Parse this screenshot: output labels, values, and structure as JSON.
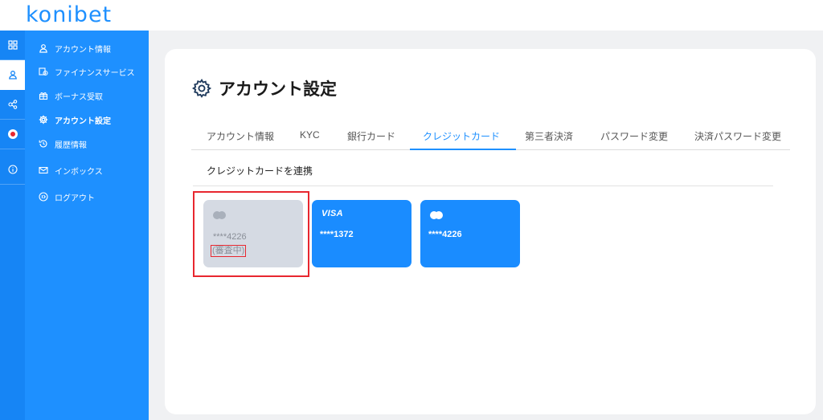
{
  "brand": {
    "logo_text": "konibet"
  },
  "rail": {
    "items": [
      {
        "icon": "grid-icon"
      },
      {
        "icon": "user-icon"
      },
      {
        "icon": "share-icon"
      },
      {
        "icon": "record-icon"
      },
      {
        "icon": "info-icon"
      }
    ]
  },
  "sidebar": {
    "items": [
      {
        "label": "アカウント情報",
        "icon": "user-icon"
      },
      {
        "label": "ファイナンスサービス",
        "icon": "finance-icon"
      },
      {
        "label": "ボーナス受取",
        "icon": "bonus-icon"
      },
      {
        "label": "アカウント設定",
        "icon": "gear-icon"
      },
      {
        "label": "履歴情報",
        "icon": "history-icon"
      },
      {
        "label": "インボックス",
        "icon": "mail-icon"
      },
      {
        "label": "ログアウト",
        "icon": "logout-icon"
      }
    ]
  },
  "page": {
    "title": "アカウント設定"
  },
  "tabs": [
    {
      "label": "アカウント情報"
    },
    {
      "label": "KYC"
    },
    {
      "label": "銀行カード"
    },
    {
      "label": "クレジットカード",
      "active": true
    },
    {
      "label": "第三者決済"
    },
    {
      "label": "パスワード変更"
    },
    {
      "label": "決済パスワード変更"
    }
  ],
  "section": {
    "link_label": "クレジットカードを連携"
  },
  "cards": [
    {
      "brand": "mastercard",
      "number": "****4226",
      "status": "(審査中)",
      "state": "pending"
    },
    {
      "brand": "VISA",
      "number": "****1372"
    },
    {
      "brand": "mastercard",
      "number": "****4226"
    }
  ],
  "colors": {
    "primary": "#1e90ff",
    "rail": "#1685f5",
    "highlight": "#e8272f",
    "pending_card": "#d5dae3"
  }
}
